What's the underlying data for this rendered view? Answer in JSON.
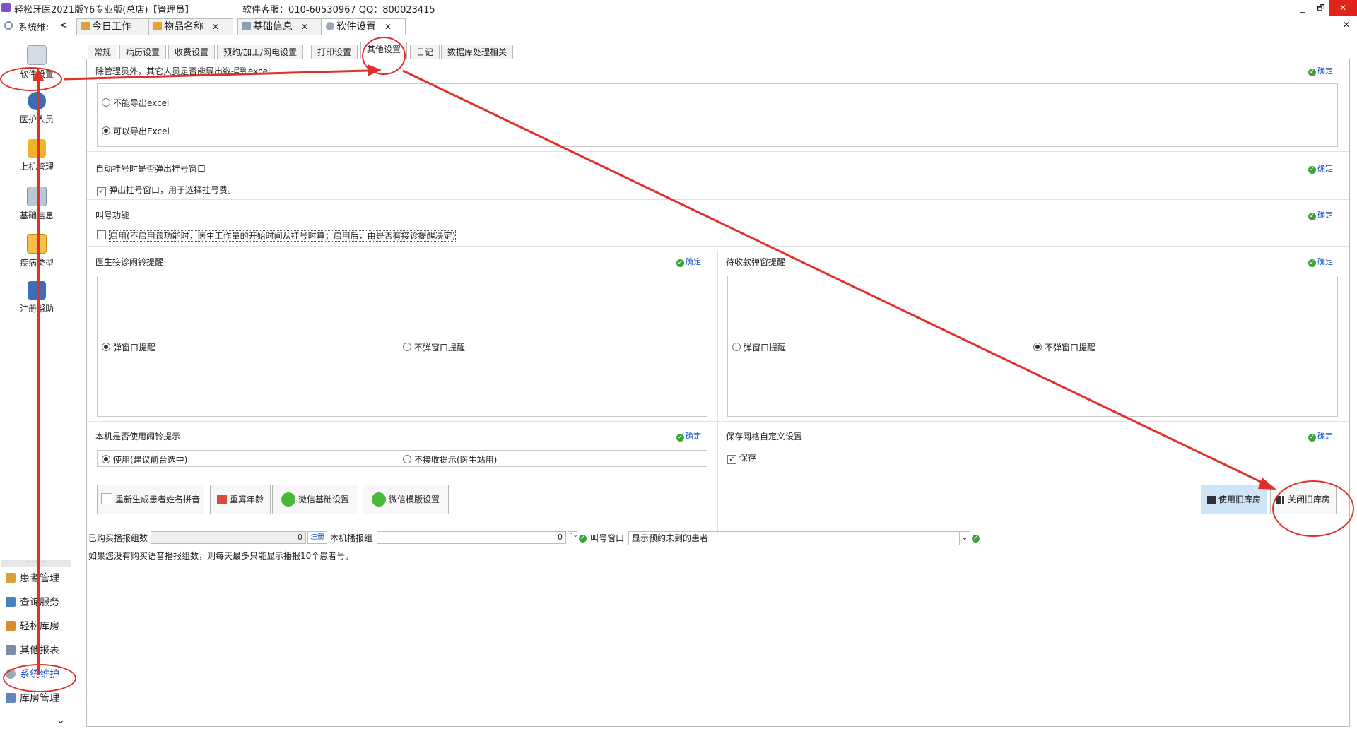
{
  "titlebar": {
    "title": "轻松牙医2021版Y6专业版(总店)【管理员】",
    "service": "软件客服：010-60530967 QQ：800023415",
    "minimize": "_",
    "restore": "🗗",
    "close": "✕"
  },
  "sidebar": {
    "header": "系统维:",
    "collapse": "<",
    "tools": [
      {
        "label": "软件设置",
        "icon": "gear-icon"
      },
      {
        "label": "医护人员",
        "icon": "staff-icon"
      },
      {
        "label": "上机管理",
        "icon": "lock-icon"
      },
      {
        "label": "基础信息",
        "icon": "info-icon"
      },
      {
        "label": "疾病类型",
        "icon": "disease-icon"
      },
      {
        "label": "注册帮助",
        "icon": "help-icon"
      }
    ],
    "dots": "· · · · ·",
    "nav": [
      {
        "label": "患者管理"
      },
      {
        "label": "查询服务"
      },
      {
        "label": "轻松库房"
      },
      {
        "label": "其他报表"
      },
      {
        "label": "系统维护"
      },
      {
        "label": "库房管理"
      }
    ],
    "scroll_down": "⌄"
  },
  "tabs": [
    {
      "label": "今日工作",
      "close": ""
    },
    {
      "label": "物品名称",
      "close": "✕"
    },
    {
      "label": "基础信息",
      "close": "✕"
    },
    {
      "label": "软件设置",
      "close": "✕"
    }
  ],
  "panel_close": "✕",
  "subtabs": [
    "常规",
    "病历设置",
    "收费设置",
    "预约/加工/网电设置",
    "打印设置",
    "其他设置",
    "日记",
    "数据库处理相关"
  ],
  "confirm_label": "确定",
  "confirm_check": "✓",
  "export": {
    "title": "除管理员外，其它人员是否能导出数据到excel",
    "options": [
      "不能导出excel",
      "可以导出Excel"
    ]
  },
  "auto_register": {
    "title": "自动挂号时是否弹出挂号窗口",
    "checkbox": "弹出挂号窗口，用于选择挂号费。",
    "check_mark": "✓"
  },
  "call_number": {
    "title": "叫号功能",
    "checkbox": "启用(不启用该功能时，医生工作量的开始时间从挂号时算；启用后，由是否有接诊提醒决定)"
  },
  "doctor_reminder": {
    "title": "医生接诊闹铃提醒",
    "options": [
      "弹窗口提醒",
      "不弹窗口提醒"
    ]
  },
  "payment_popup": {
    "title": "待收款弹窗提醒",
    "options": [
      "弹窗口提醒",
      "不弹窗口提醒"
    ]
  },
  "local_alarm": {
    "title": "本机是否使用闹铃提示",
    "options": [
      "使用(建议前台选中)",
      "不接收提示(医生站用)"
    ]
  },
  "grid_save": {
    "title": "保存网格自定义设置",
    "checkbox": "保存",
    "check_mark": "✓"
  },
  "actions": [
    {
      "label": "重新生成患者姓名拼音",
      "icon": "abc-icon"
    },
    {
      "label": "重算年龄",
      "icon": "calendar-icon"
    },
    {
      "label": "微信基础设置",
      "icon": "wechat-icon"
    },
    {
      "label": "微信模版设置",
      "icon": "wechat-icon"
    }
  ],
  "warehouse": {
    "use_old": "使用旧库房",
    "close_old": "关闭旧库房"
  },
  "broadcast": {
    "purchased_label": "已购买播报组数",
    "purchased_value": "0",
    "register_button": "注册",
    "local_label": "本机播报组",
    "local_value": "0",
    "spin": "⌃⌄",
    "window_label": "叫号窗口",
    "window_value": "显示预约未到的患者",
    "dropdown": "⌄",
    "note": "如果您没有购买语音播报组数，则每天最多只能显示播报10个患者号。"
  },
  "colors": {
    "annotation": "#e0302a",
    "confirm_link": "#1a56c4",
    "active_side": "#1a56c4",
    "use_old_bg": "#cfe4f7"
  }
}
